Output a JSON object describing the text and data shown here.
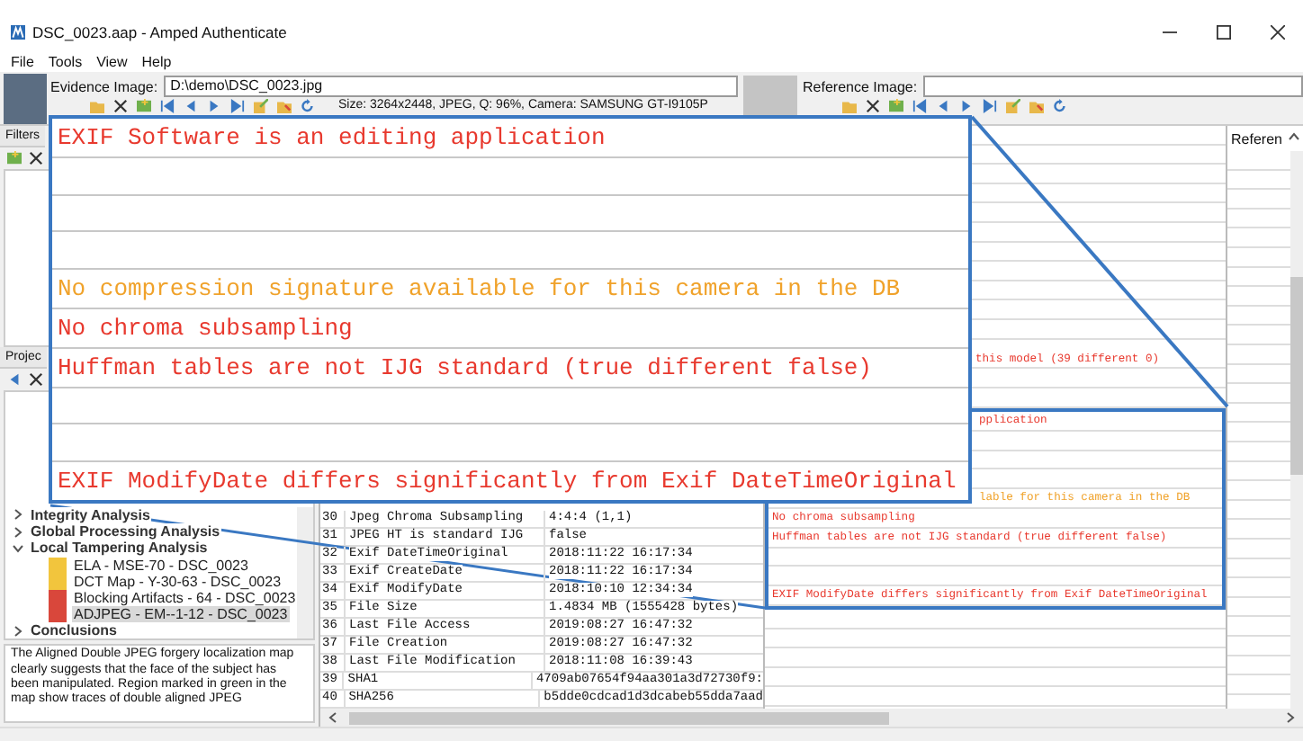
{
  "window": {
    "title": "DSC_0023.aap - Amped Authenticate"
  },
  "menu": [
    "File",
    "Tools",
    "View",
    "Help"
  ],
  "evidence": {
    "label": "Evidence Image:",
    "value": "D:\\demo\\DSC_0023.jpg",
    "info": "Size: 3264x2448, JPEG, Q: 96%, Camera: SAMSUNG GT-I9105P"
  },
  "reference": {
    "label": "Reference Image:"
  },
  "filters_panel": {
    "title": "Filters"
  },
  "project_panel": {
    "title": "Projec",
    "tree": [
      {
        "label": "Integrity Analysis",
        "expanded": false,
        "selected": false
      },
      {
        "label": "Global Processing Analysis",
        "expanded": false,
        "selected": false
      },
      {
        "label": "Local Tampering Analysis",
        "expanded": true,
        "selected": false,
        "children": [
          {
            "label": "ELA - MSE-70 - DSC_0023",
            "color": "#f2c53d",
            "selected": false
          },
          {
            "label": "DCT Map - Y-30-63 - DSC_0023",
            "color": "#f2c53d",
            "selected": false
          },
          {
            "label": "Blocking Artifacts - 64 - DSC_0023",
            "color": "#d9473b",
            "selected": false
          },
          {
            "label": "ADJPEG - EM--1-12 - DSC_0023",
            "color": "#d9473b",
            "selected": true
          }
        ]
      },
      {
        "label": "Conclusions",
        "expanded": false,
        "selected": false
      }
    ],
    "description": "The Aligned Double JPEG forgery localization map clearly suggests that the face of the subject has been manipulated. Region marked in green in the map show traces of double aligned JPEG"
  },
  "table": {
    "rows": [
      {
        "number": "30",
        "name": "Jpeg Chroma Subsampling",
        "value": "4:4:4 (1,1)"
      },
      {
        "number": "31",
        "name": "JPEG HT is standard IJG",
        "value": "false"
      },
      {
        "number": "32",
        "name": "Exif DateTimeOriginal",
        "value": "2018:11:22 16:17:34"
      },
      {
        "number": "33",
        "name": "Exif CreateDate",
        "value": "2018:11:22 16:17:34"
      },
      {
        "number": "34",
        "name": "Exif ModifyDate",
        "value": "2018:10:10 12:34:34"
      },
      {
        "number": "35",
        "name": "File Size",
        "value": "1.4834 MB (1555428 bytes)"
      },
      {
        "number": "36",
        "name": "Last File Access",
        "value": "2019:08:27 16:47:32"
      },
      {
        "number": "37",
        "name": "File Creation",
        "value": "2019:08:27 16:47:32"
      },
      {
        "number": "38",
        "name": "Last File Modification",
        "value": "2018:11:08 16:39:43"
      },
      {
        "number": "39",
        "name": "SHA1",
        "value": "4709ab07654f94aa301a3d72730f9:"
      },
      {
        "number": "40",
        "name": "SHA256",
        "value": "b5dde0cdcad1d3dcabeb55dda7aad"
      }
    ]
  },
  "results": {
    "column_header": "Referen",
    "rows": [
      {
        "kind": "text",
        "text": "this model (39 different 0)",
        "color": "#e8392e",
        "covered": true
      },
      {
        "kind": "blank"
      },
      {
        "kind": "blank"
      }
    ],
    "source_rows": [
      {
        "kind": "text",
        "text": "pplication",
        "color": "#e8392e",
        "covered": true
      },
      {
        "kind": "blank"
      },
      {
        "kind": "blank"
      },
      {
        "kind": "blank"
      },
      {
        "kind": "text",
        "text": "lable for this camera in the DB",
        "color": "#f0a22a",
        "covered": true
      },
      {
        "kind": "text",
        "text": "No chroma subsampling",
        "color": "#e8392e",
        "covered": false
      },
      {
        "kind": "text",
        "text": "Huffman tables are not IJG standard (true different false)",
        "color": "#e8392e",
        "covered": false
      },
      {
        "kind": "blank"
      },
      {
        "kind": "blank"
      },
      {
        "kind": "text",
        "text": "EXIF ModifyDate differs significantly from Exif DateTimeOriginal",
        "color": "#e8392e",
        "covered": false
      }
    ]
  },
  "callout": {
    "rows": [
      {
        "kind": "text",
        "text": "EXIF Software is an editing application",
        "color": "#e8392e"
      },
      {
        "kind": "blank"
      },
      {
        "kind": "blank"
      },
      {
        "kind": "blank"
      },
      {
        "kind": "text",
        "text": "No compression signature available for this camera in the DB",
        "color": "#f0a22a"
      },
      {
        "kind": "text",
        "text": "No chroma subsampling",
        "color": "#e8392e"
      },
      {
        "kind": "text",
        "text": "Huffman tables are not IJG standard (true different false)",
        "color": "#e8392e"
      },
      {
        "kind": "blank"
      },
      {
        "kind": "blank"
      },
      {
        "kind": "text",
        "text": "EXIF ModifyDate differs significantly from Exif DateTimeOriginal",
        "color": "#e8392e"
      }
    ]
  }
}
